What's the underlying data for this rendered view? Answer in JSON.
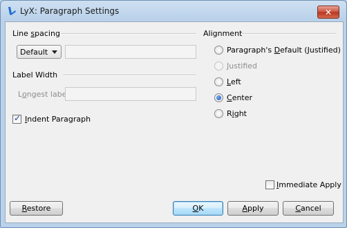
{
  "window": {
    "title": "LyX: Paragraph Settings",
    "close_glyph": "✕"
  },
  "line_spacing": {
    "label_pre": "Line ",
    "label_key": "s",
    "label_post": "pacing",
    "combo_value": "Default",
    "value": ""
  },
  "label_width": {
    "label": "Label Width",
    "longest_pre": "L",
    "longest_key": "o",
    "longest_post": "ngest label",
    "value": ""
  },
  "indent": {
    "label_key": "I",
    "label_post": "ndent Paragraph",
    "checked": true
  },
  "alignment": {
    "label": "Alignment",
    "options": [
      {
        "pre": "Paragraph's ",
        "key": "D",
        "post": "efault (Justified)",
        "enabled": true,
        "selected": false
      },
      {
        "pre": "",
        "key": "J",
        "post": "ustified",
        "enabled": false,
        "selected": false
      },
      {
        "pre": "",
        "key": "L",
        "post": "eft",
        "enabled": true,
        "selected": false
      },
      {
        "pre": "",
        "key": "C",
        "post": "enter",
        "enabled": true,
        "selected": true
      },
      {
        "pre": "R",
        "key": "i",
        "post": "ght",
        "enabled": true,
        "selected": false
      }
    ]
  },
  "immediate_apply": {
    "label_key": "I",
    "label_post": "mmediate Apply",
    "checked": false
  },
  "buttons": {
    "restore_key": "R",
    "restore_post": "estore",
    "ok_key": "O",
    "ok_post": "K",
    "apply_key": "A",
    "apply_post": "pply",
    "cancel_key": "C",
    "cancel_post": "ancel"
  },
  "colors": {
    "accent": "#1c4ea8",
    "close": "#c9523e"
  }
}
